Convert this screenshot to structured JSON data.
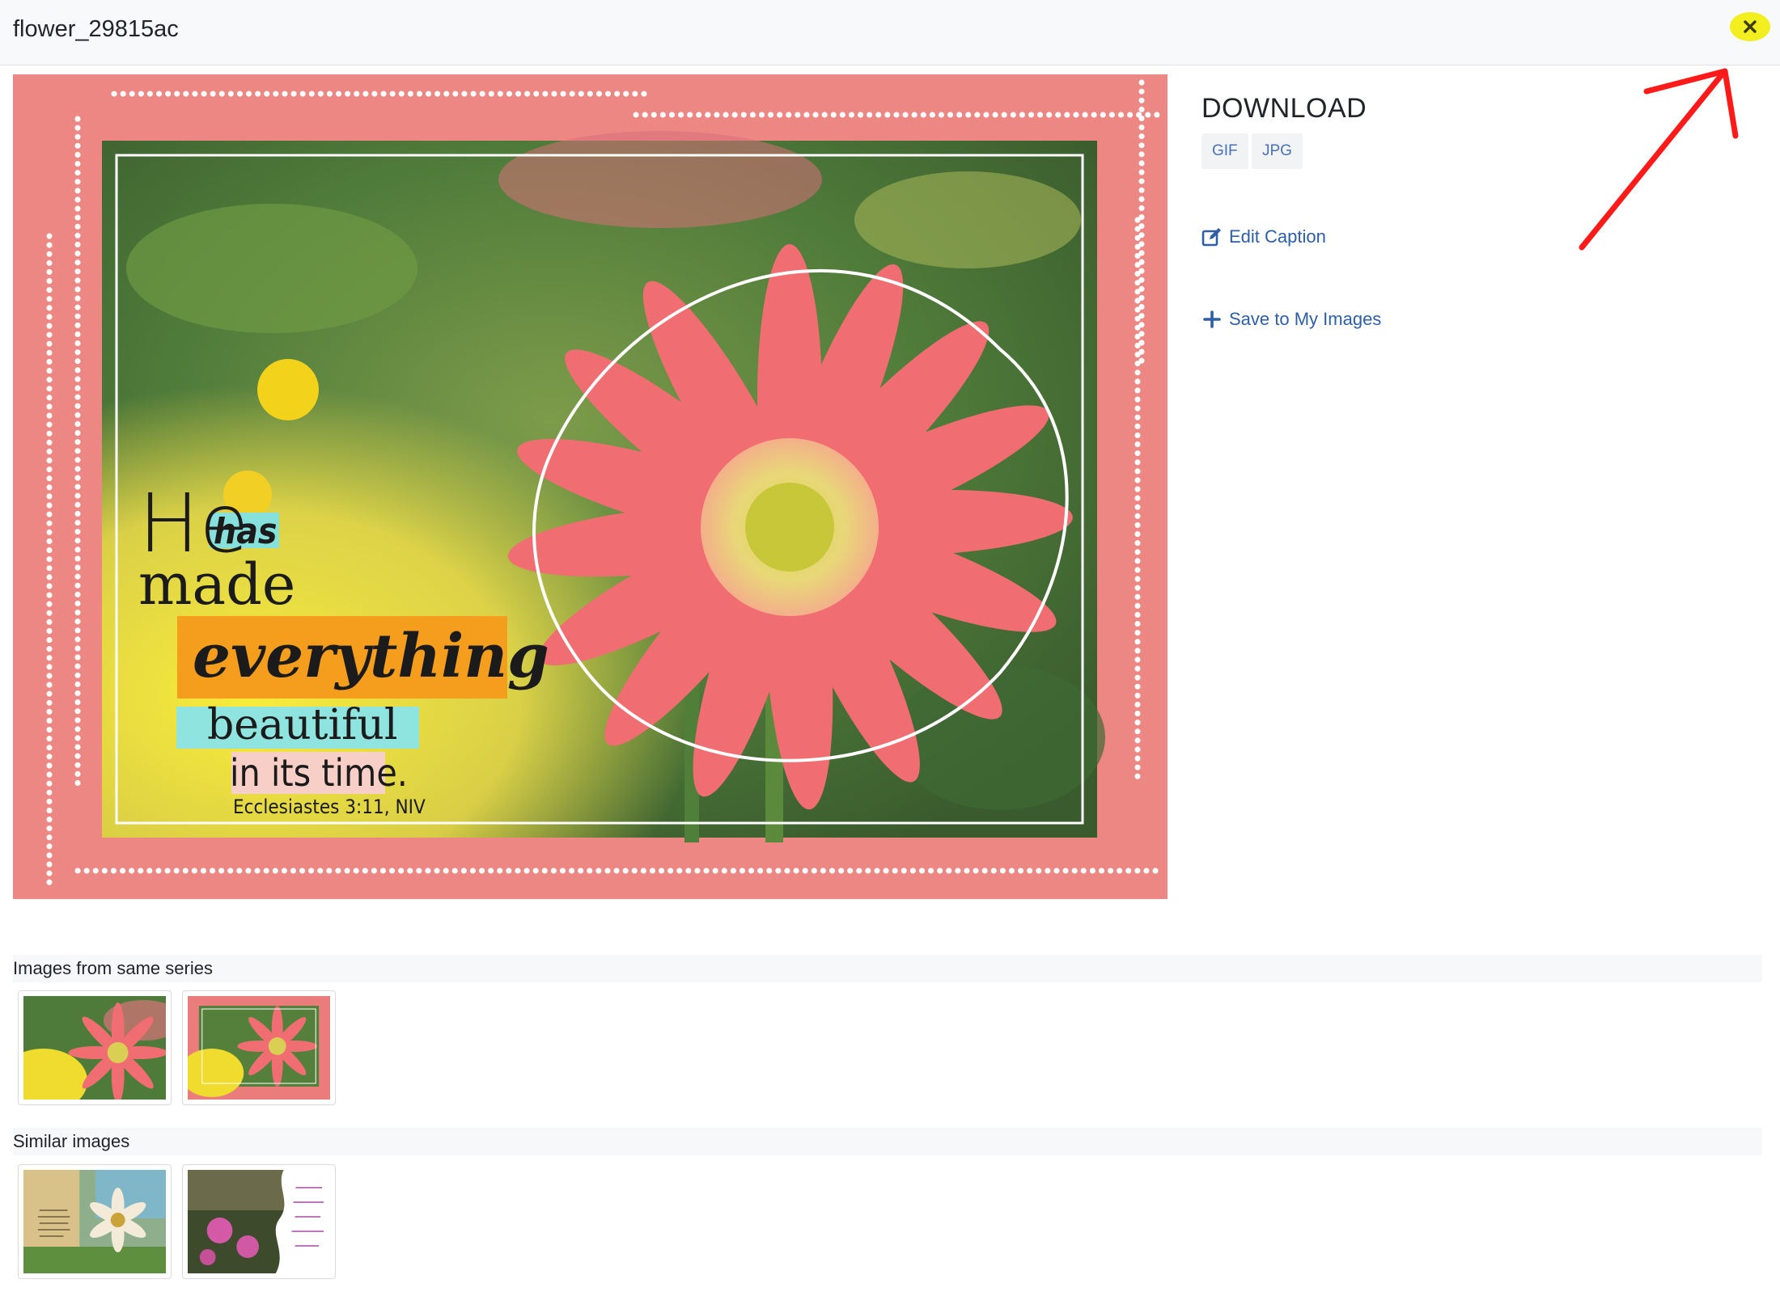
{
  "header": {
    "title": "flower_29815ac"
  },
  "main_image": {
    "text_he": "He",
    "text_has": "has",
    "text_made": "made",
    "text_everything": "everything",
    "text_beautiful": "beautiful",
    "text_in_its_time": "in its time.",
    "text_reference": "Ecclesiastes 3:11, NIV"
  },
  "download": {
    "title": "DOWNLOAD",
    "formats": [
      "GIF",
      "JPG"
    ]
  },
  "actions": {
    "edit_caption": "Edit Caption",
    "save": "Save to My Images"
  },
  "sections": {
    "series": "Images from same series",
    "similar": "Similar images"
  },
  "colors": {
    "accent_link": "#2d5ea8",
    "close_highlight": "#f2ee1f",
    "annotation_arrow": "#ff1a1a",
    "frame_pink": "#ea7d7c"
  },
  "icons": {
    "close": "close-icon",
    "edit": "edit-icon",
    "plus": "plus-icon"
  }
}
